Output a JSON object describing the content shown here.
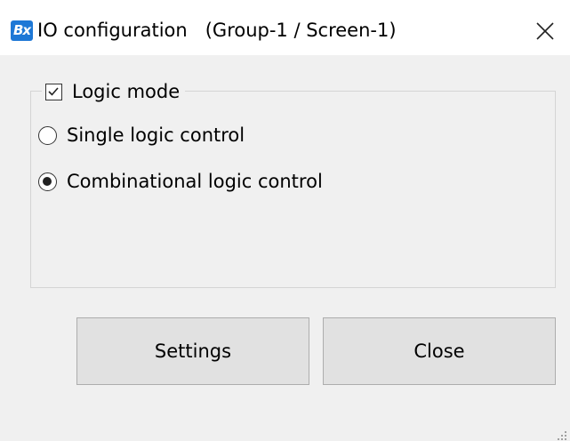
{
  "window": {
    "title": "IO configuration   (Group-1 / Screen-1)",
    "app_icon_label": "Bx"
  },
  "group": {
    "label": "Logic mode",
    "checked": true
  },
  "options": [
    {
      "label": "Single logic control",
      "selected": false
    },
    {
      "label": "Combinational logic control",
      "selected": true
    }
  ],
  "buttons": {
    "settings_label": "Settings",
    "close_label": "Close"
  },
  "colors": {
    "titlebar_bg": "#ffffff",
    "window_bg": "#f0f0f0",
    "button_bg": "#e1e1e1",
    "app_icon_bg": "#1e78d6"
  }
}
